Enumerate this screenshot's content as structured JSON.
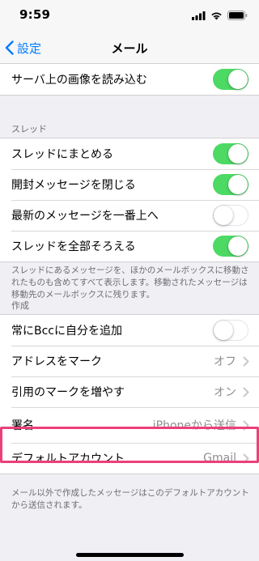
{
  "status": {
    "time": "9:59"
  },
  "nav": {
    "back_label": "設定",
    "title": "メール"
  },
  "group_top": {
    "rows": [
      {
        "label": "サーバ上の画像を読み込む",
        "toggle": true
      }
    ]
  },
  "thread": {
    "header": "スレッド",
    "rows": [
      {
        "label": "スレッドにまとめる",
        "toggle": true
      },
      {
        "label": "開封メッセージを閉じる",
        "toggle": true
      },
      {
        "label": "最新のメッセージを一番上へ",
        "toggle": false
      },
      {
        "label": "スレッドを全部そろえる",
        "toggle": true
      }
    ],
    "footer": "スレッドにあるメッセージを、ほかのメールボックスに移動されたものも含めてすべて表示します。移動されたメッセージは移動先のメールボックスに残ります。"
  },
  "compose": {
    "header": "作成",
    "rows": [
      {
        "label": "常にBccに自分を追加",
        "toggle": false
      },
      {
        "label": "アドレスをマーク",
        "value": "オフ"
      },
      {
        "label": "引用のマークを増やす",
        "value": "オン"
      },
      {
        "label": "署名",
        "value": "iPhoneから送信"
      },
      {
        "label": "デフォルトアカウント",
        "value": "Gmail"
      }
    ],
    "footer": "メール以外で作成したメッセージはこのデフォルトアカウントから送信されます。"
  },
  "colors": {
    "accent": "#007aff",
    "toggle_on": "#4cd964",
    "highlight": "#ec3f7a"
  },
  "icons": [
    "signal-icon",
    "wifi-icon",
    "battery-icon",
    "back-chevron-icon",
    "chevron-right-icon"
  ]
}
